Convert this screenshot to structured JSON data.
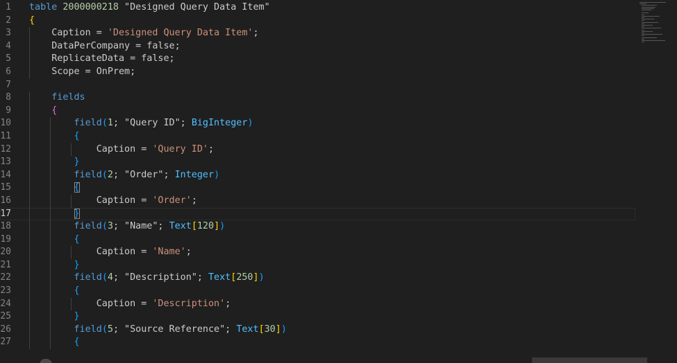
{
  "editor": {
    "lines": [
      {
        "n": "1",
        "tokens": [
          {
            "t": "table",
            "c": "kw"
          },
          {
            "t": " "
          },
          {
            "t": "2000000218",
            "c": "num"
          },
          {
            "t": " \"Designed Query Data Item\""
          }
        ]
      },
      {
        "n": "2",
        "tokens": [
          {
            "t": "{",
            "c": "b1"
          }
        ]
      },
      {
        "n": "3",
        "tokens": [
          {
            "t": "    Caption = "
          },
          {
            "t": "'Designed Query Data Item'",
            "c": "str"
          },
          {
            "t": ";"
          }
        ]
      },
      {
        "n": "4",
        "tokens": [
          {
            "t": "    DataPerCompany = false;"
          }
        ]
      },
      {
        "n": "5",
        "tokens": [
          {
            "t": "    ReplicateData = false;"
          }
        ]
      },
      {
        "n": "6",
        "tokens": [
          {
            "t": "    Scope = OnPrem;"
          }
        ]
      },
      {
        "n": "7",
        "tokens": []
      },
      {
        "n": "8",
        "tokens": [
          {
            "t": "    "
          },
          {
            "t": "fields",
            "c": "kw"
          }
        ]
      },
      {
        "n": "9",
        "tokens": [
          {
            "t": "    "
          },
          {
            "t": "{",
            "c": "b2"
          }
        ]
      },
      {
        "n": "10",
        "tokens": [
          {
            "t": "        "
          },
          {
            "t": "field",
            "c": "kw"
          },
          {
            "t": "(",
            "c": "b3"
          },
          {
            "t": "1",
            "c": "num"
          },
          {
            "t": "; \"Query ID\"; "
          },
          {
            "t": "BigInteger",
            "c": "ty"
          },
          {
            "t": ")",
            "c": "b3"
          }
        ]
      },
      {
        "n": "11",
        "tokens": [
          {
            "t": "        "
          },
          {
            "t": "{",
            "c": "b3"
          }
        ]
      },
      {
        "n": "12",
        "tokens": [
          {
            "t": "            Caption = "
          },
          {
            "t": "'Query ID'",
            "c": "str"
          },
          {
            "t": ";"
          }
        ]
      },
      {
        "n": "13",
        "tokens": [
          {
            "t": "        "
          },
          {
            "t": "}",
            "c": "b3"
          }
        ]
      },
      {
        "n": "14",
        "tokens": [
          {
            "t": "        "
          },
          {
            "t": "field",
            "c": "kw"
          },
          {
            "t": "(",
            "c": "b3"
          },
          {
            "t": "2",
            "c": "num"
          },
          {
            "t": "; \"Order\"; "
          },
          {
            "t": "Integer",
            "c": "ty"
          },
          {
            "t": ")",
            "c": "b3"
          }
        ]
      },
      {
        "n": "15",
        "tokens": [
          {
            "t": "        "
          },
          {
            "t": "{",
            "c": "b3 bm"
          }
        ]
      },
      {
        "n": "16",
        "tokens": [
          {
            "t": "            Caption = "
          },
          {
            "t": "'Order'",
            "c": "str"
          },
          {
            "t": ";"
          }
        ]
      },
      {
        "n": "17",
        "tokens": [
          {
            "t": "        "
          },
          {
            "t": "}",
            "c": "b3 bm"
          }
        ],
        "current": true
      },
      {
        "n": "18",
        "tokens": [
          {
            "t": "        "
          },
          {
            "t": "field",
            "c": "kw"
          },
          {
            "t": "(",
            "c": "b3"
          },
          {
            "t": "3",
            "c": "num"
          },
          {
            "t": "; \"Name\"; "
          },
          {
            "t": "Text",
            "c": "ty"
          },
          {
            "t": "[",
            "c": "b1"
          },
          {
            "t": "120",
            "c": "num"
          },
          {
            "t": "]",
            "c": "b1"
          },
          {
            "t": ")",
            "c": "b3"
          }
        ]
      },
      {
        "n": "19",
        "tokens": [
          {
            "t": "        "
          },
          {
            "t": "{",
            "c": "b3"
          }
        ]
      },
      {
        "n": "20",
        "tokens": [
          {
            "t": "            Caption = "
          },
          {
            "t": "'Name'",
            "c": "str"
          },
          {
            "t": ";"
          }
        ]
      },
      {
        "n": "21",
        "tokens": [
          {
            "t": "        "
          },
          {
            "t": "}",
            "c": "b3"
          }
        ]
      },
      {
        "n": "22",
        "tokens": [
          {
            "t": "        "
          },
          {
            "t": "field",
            "c": "kw"
          },
          {
            "t": "(",
            "c": "b3"
          },
          {
            "t": "4",
            "c": "num"
          },
          {
            "t": "; \"Description\"; "
          },
          {
            "t": "Text",
            "c": "ty"
          },
          {
            "t": "[",
            "c": "b1"
          },
          {
            "t": "250",
            "c": "num"
          },
          {
            "t": "]",
            "c": "b1"
          },
          {
            "t": ")",
            "c": "b3"
          }
        ]
      },
      {
        "n": "23",
        "tokens": [
          {
            "t": "        "
          },
          {
            "t": "{",
            "c": "b3"
          }
        ]
      },
      {
        "n": "24",
        "tokens": [
          {
            "t": "            Caption = "
          },
          {
            "t": "'Description'",
            "c": "str"
          },
          {
            "t": ";"
          }
        ]
      },
      {
        "n": "25",
        "tokens": [
          {
            "t": "        "
          },
          {
            "t": "}",
            "c": "b3"
          }
        ]
      },
      {
        "n": "26",
        "tokens": [
          {
            "t": "        "
          },
          {
            "t": "field",
            "c": "kw"
          },
          {
            "t": "(",
            "c": "b3"
          },
          {
            "t": "5",
            "c": "num"
          },
          {
            "t": "; \"Source Reference\"; "
          },
          {
            "t": "Text",
            "c": "ty"
          },
          {
            "t": "[",
            "c": "b1"
          },
          {
            "t": "30",
            "c": "num"
          },
          {
            "t": "]",
            "c": "b1"
          },
          {
            "t": ")",
            "c": "b3"
          }
        ]
      },
      {
        "n": "27",
        "tokens": [
          {
            "t": "        "
          },
          {
            "t": "{",
            "c": "b3"
          }
        ]
      }
    ]
  },
  "colors": {
    "background": "#1f1f1f",
    "keyword": "#569cd6",
    "number": "#b5cea8",
    "string": "#ce9178",
    "type": "#4fc1ff",
    "bracket_level1": "#ffd700",
    "bracket_level2": "#da70d6",
    "bracket_level3": "#179fff",
    "line_number": "#858585"
  },
  "icons": {
    "minimap": "minimap-overview",
    "scrollbar": "horizontal-scrollbar"
  }
}
